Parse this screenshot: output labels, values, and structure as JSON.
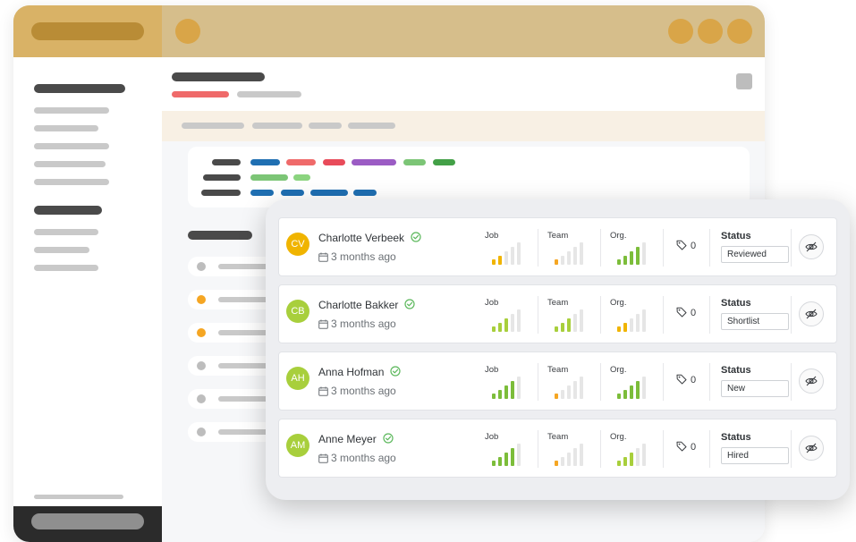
{
  "colors": {
    "titlebar": "#d6be8b",
    "titlebar_left": "#d9b266",
    "accent_red": "#ef6a6a",
    "signal_green": "#7cbd3a",
    "signal_yellow": "#f0b400",
    "signal_orange": "#f5a623",
    "signal_empty": "#e6e6e6"
  },
  "candidates": [
    {
      "initials": "CV",
      "avatar_color": "#f0b400",
      "name": "Charlotte Verbeek",
      "verified_icon": "check-circle-icon",
      "time": "3 months ago",
      "job_label": "Job",
      "job_level": 2,
      "job_color": "#f0b400",
      "team_label": "Team",
      "team_level": 1,
      "team_color": "#f5a623",
      "org_label": "Org.",
      "org_level": 4,
      "org_color": "#7cbd3a",
      "tags_count": "0",
      "status_label": "Status",
      "status": "Reviewed"
    },
    {
      "initials": "CB",
      "avatar_color": "#a8cf3c",
      "name": "Charlotte Bakker",
      "verified_icon": "check-circle-icon",
      "time": "3 months ago",
      "job_label": "Job",
      "job_level": 3,
      "job_color": "#a8cf3c",
      "team_label": "Team",
      "team_level": 3,
      "team_color": "#a8cf3c",
      "org_label": "Org.",
      "org_level": 2,
      "org_color": "#f0b400",
      "tags_count": "0",
      "status_label": "Status",
      "status": "Shortlist"
    },
    {
      "initials": "AH",
      "avatar_color": "#a8cf3c",
      "name": "Anna Hofman",
      "verified_icon": "check-circle-icon",
      "time": "3 months ago",
      "job_label": "Job",
      "job_level": 4,
      "job_color": "#7cbd3a",
      "team_label": "Team",
      "team_level": 1,
      "team_color": "#f5a623",
      "org_label": "Org.",
      "org_level": 4,
      "org_color": "#7cbd3a",
      "tags_count": "0",
      "status_label": "Status",
      "status": "New"
    },
    {
      "initials": "AM",
      "avatar_color": "#a8cf3c",
      "name": "Anne Meyer",
      "verified_icon": "check-circle-icon",
      "time": "3 months ago",
      "job_label": "Job",
      "job_level": 4,
      "job_color": "#7cbd3a",
      "team_label": "Team",
      "team_level": 1,
      "team_color": "#f5a623",
      "org_label": "Org.",
      "org_level": 3,
      "org_color": "#a8cf3c",
      "tags_count": "0",
      "status_label": "Status",
      "status": "Hired"
    }
  ]
}
